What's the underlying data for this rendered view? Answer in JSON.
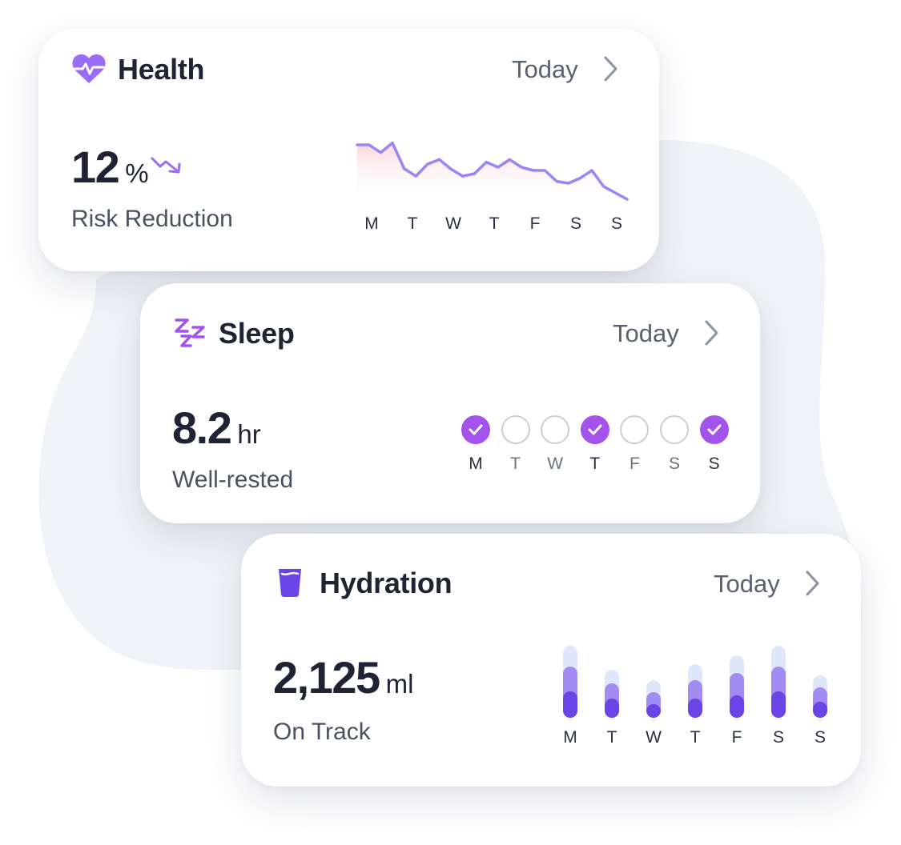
{
  "colors": {
    "accent": "#9b6cf5",
    "sleep_done": "#a353eb",
    "hydration_dark": "#6b44e8",
    "hydration_mid": "#a28cf4",
    "hydration_light": "#dfe7fb",
    "background_blob": "#f0f3f8"
  },
  "health": {
    "icon": "heart-pulse-icon",
    "title": "Health",
    "period": "Today",
    "value": "12",
    "unit": "%",
    "trend_icon": "trend-down-icon",
    "label": "Risk Reduction",
    "days": [
      "M",
      "T",
      "W",
      "T",
      "F",
      "S",
      "S"
    ],
    "chart_data": {
      "type": "area",
      "categories": [
        "M",
        "T",
        "W",
        "T",
        "F",
        "S",
        "S"
      ],
      "values": [
        85,
        85,
        73,
        88,
        48,
        36,
        55,
        62,
        47,
        36,
        40,
        58,
        50,
        62,
        50,
        45,
        45,
        28,
        25,
        33,
        45,
        20,
        10,
        0
      ],
      "title": "",
      "xlabel": "",
      "ylabel": ""
    }
  },
  "sleep": {
    "icon": "zzz-icon",
    "title": "Sleep",
    "period": "Today",
    "value": "8.2",
    "unit": "hr",
    "label": "Well-rested",
    "days": [
      {
        "label": "M",
        "done": true
      },
      {
        "label": "T",
        "done": false
      },
      {
        "label": "W",
        "done": false
      },
      {
        "label": "T",
        "done": true
      },
      {
        "label": "F",
        "done": false
      },
      {
        "label": "S",
        "done": false
      },
      {
        "label": "S",
        "done": true
      }
    ]
  },
  "hydration": {
    "icon": "water-glass-icon",
    "title": "Hydration",
    "period": "Today",
    "value": "2,125",
    "unit": "ml",
    "label": "On Track",
    "days": [
      "M",
      "T",
      "W",
      "T",
      "F",
      "S",
      "S"
    ],
    "chart_data": {
      "type": "bar",
      "categories": [
        "M",
        "T",
        "W",
        "T",
        "F",
        "S",
        "S"
      ],
      "series": [
        {
          "values": [
            33,
            24,
            17,
            24,
            28,
            33,
            20
          ]
        },
        {
          "values": [
            64,
            43,
            32,
            47,
            56,
            64,
            38
          ]
        },
        {
          "values": [
            90,
            60,
            47,
            67,
            78,
            90,
            53
          ]
        }
      ],
      "ylim": [
        0,
        90
      ]
    }
  }
}
